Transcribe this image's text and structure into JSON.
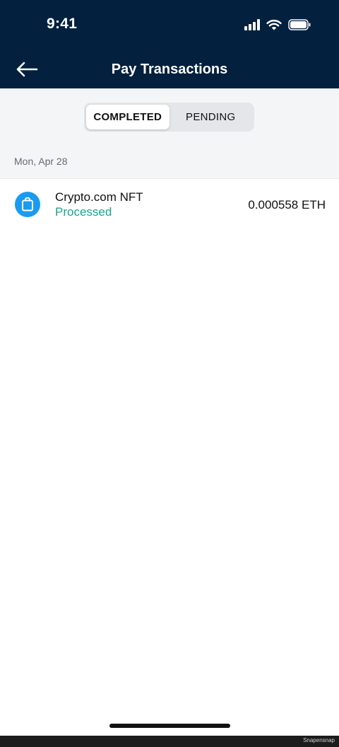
{
  "status_bar": {
    "time": "9:41",
    "icons": [
      "cellular-signal-icon",
      "wifi-icon",
      "battery-icon"
    ]
  },
  "nav": {
    "title": "Pay Transactions",
    "back_icon": "arrow-left-icon"
  },
  "tabs": [
    {
      "label": "COMPLETED",
      "active": true
    },
    {
      "label": "PENDING",
      "active": false
    }
  ],
  "sections": [
    {
      "date": "Mon, Apr 28",
      "transactions": [
        {
          "merchant": "Crypto.com NFT",
          "status": "Processed",
          "amount": "0.000558 ETH",
          "icon": "shopping-bag-icon"
        }
      ]
    }
  ],
  "watermark": "Snapensnap",
  "colors": {
    "header_bg": "#03203f",
    "accent_blue": "#1a9bf0",
    "status_green": "#1ba58a",
    "segment_bg": "#e4e6e9",
    "page_bg": "#f4f5f7"
  }
}
